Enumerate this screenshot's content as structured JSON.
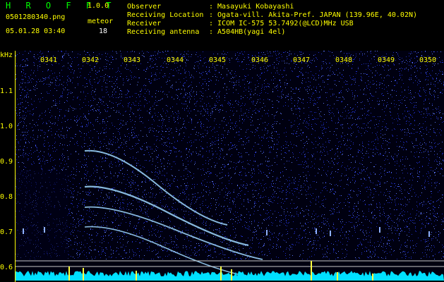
{
  "header": {
    "app_title": "H R O F F T",
    "version": "1.0.0",
    "filename": "0501280340.png",
    "meteor_label": "meteor",
    "meteor_count": "18",
    "datetime": "05.01.28 03:40",
    "fields": [
      {
        "label": "Observer",
        "value": ": Masayuki Kobayashi"
      },
      {
        "label": "Receiving Location",
        "value": ": Ogata-vill. Akita-Pref. JAPAN (139.96E, 40.02N)"
      },
      {
        "label": "Receiver",
        "value": ": ICOM IC-575 53.7492(@LCD)MHz USB"
      },
      {
        "label": "Receiving antenna",
        "value": ": A504HB(yagi 4el)"
      }
    ]
  },
  "axis": {
    "unit": "kHz",
    "freq_ticks": [
      "1.1",
      "1.0",
      "0.9",
      "0.8",
      "0.7",
      "0.6"
    ],
    "time_ticks": [
      "0341",
      "0342",
      "0343",
      "0344",
      "0345",
      "0346",
      "0347",
      "0348",
      "0349",
      "0350"
    ]
  },
  "colors": {
    "background": "#000010",
    "noise": "#2a3cff",
    "echo": "#9fd8ff",
    "label": "#ffff00",
    "field": "#00ffff",
    "baseline": "#00e0ff"
  }
}
